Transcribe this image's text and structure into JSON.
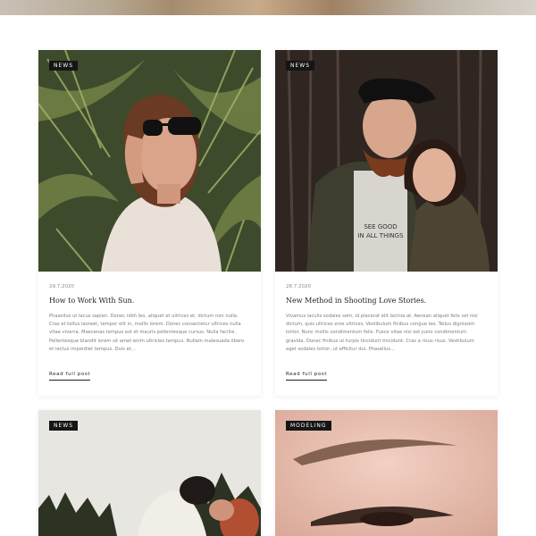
{
  "posts": [
    {
      "category": "NEWS",
      "date": "29.7.2020",
      "title": "How to Work With Sun.",
      "excerpt": "Phasellus ut lacus sapien. Donec nibh leo, aliquet et ultrices et, dictum non nulla. Cras et tellus laoreet, tempor elit in, mollis lorem. Donec consectetur ultrices nulla vitae viverra. Maecenas tempus est et mauris pellentesque cursus. Nulla facilisi. Pellentesque blandit lorem sit amet enim ultricies tempus. Nullam malesuada libero et lectus imperdiet tempus. Duis et...",
      "read_more": "Read full post"
    },
    {
      "category": "NEWS",
      "date": "28.7.2020",
      "title": "New Method in Shooting Love Stories.",
      "excerpt": "Vivamus iaculis sodales sem, id placerat elit lacinia at. Aenean aliquet felis vel nisi dictum, quis ultrices eros ultrices. Vestibulum finibus congue leo. Tellus dignissim tortor. Nunc mollis condimentum felis. Fusce vitae nisl est justo condimentum gravida. Donec finibus ut turpis tincidunt tincidunt. Cras a risus risus. Vestibulum eget sodales tortor, ut efficitur dui. Phasellus...",
      "read_more": "Read full post"
    },
    {
      "category": "NEWS"
    },
    {
      "category": "MODELING"
    }
  ],
  "photo_shirt_text": [
    "SEE GOOD",
    "IN ALL THINGS"
  ]
}
